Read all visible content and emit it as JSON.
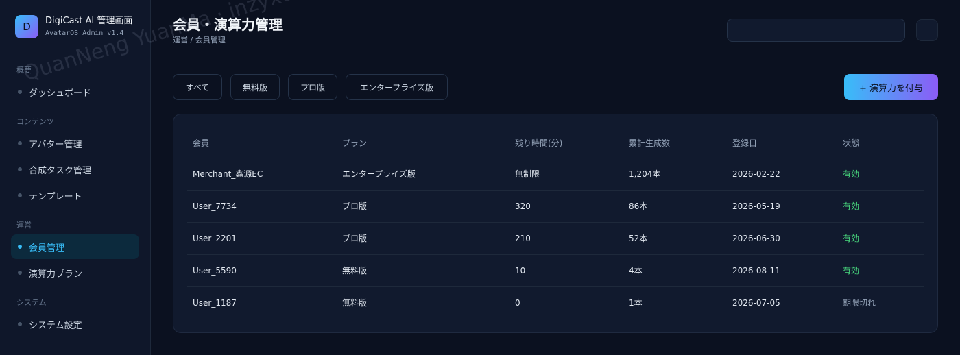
{
  "brand": {
    "logo_letter": "D",
    "title": "DigiCast AI 管理画面",
    "subtitle": "AvatarOS Admin v1.4"
  },
  "sidebar": {
    "sections": [
      {
        "label": "概要",
        "items": [
          {
            "label": "ダッシュボード",
            "active": false
          }
        ]
      },
      {
        "label": "コンテンツ",
        "items": [
          {
            "label": "アバター管理",
            "active": false
          },
          {
            "label": "合成タスク管理",
            "active": false
          },
          {
            "label": "テンプレート",
            "active": false
          }
        ]
      },
      {
        "label": "運営",
        "items": [
          {
            "label": "会員管理",
            "active": true
          },
          {
            "label": "演算力プラン",
            "active": false
          }
        ]
      },
      {
        "label": "システム",
        "items": [
          {
            "label": "システム設定",
            "active": false
          }
        ]
      }
    ]
  },
  "header": {
    "title": "会員・演算力管理",
    "breadcrumb": "運営 / 会員管理",
    "search_value": ""
  },
  "filters": [
    "すべて",
    "無料版",
    "プロ版",
    "エンタープライズ版"
  ],
  "primary_action": "+ 演算力を付与",
  "table": {
    "columns": [
      "会員",
      "プラン",
      "残り時間(分)",
      "累計生成数",
      "登録日",
      "状態"
    ],
    "rows": [
      [
        "Merchant_鑫源EC",
        "エンタープライズ版",
        "無制限",
        "1,204本",
        "2026-02-22",
        "有効"
      ],
      [
        "User_7734",
        "プロ版",
        "320",
        "86本",
        "2026-05-19",
        "有効"
      ],
      [
        "User_2201",
        "プロ版",
        "210",
        "52本",
        "2026-06-30",
        "有効"
      ],
      [
        "User_5590",
        "無料版",
        "10",
        "4本",
        "2026-08-11",
        "有効"
      ],
      [
        "User_1187",
        "無料版",
        "0",
        "1本",
        "2026-07-05",
        "期限切れ"
      ]
    ]
  },
  "watermark": "QuanNeng YuanMa · inzyxuashop.com",
  "colors": {
    "accent": "#38bdf8",
    "accent_gradient_end": "#8b5cf6",
    "status_active": "#4ade80",
    "status_expired": "#94a3b8"
  }
}
